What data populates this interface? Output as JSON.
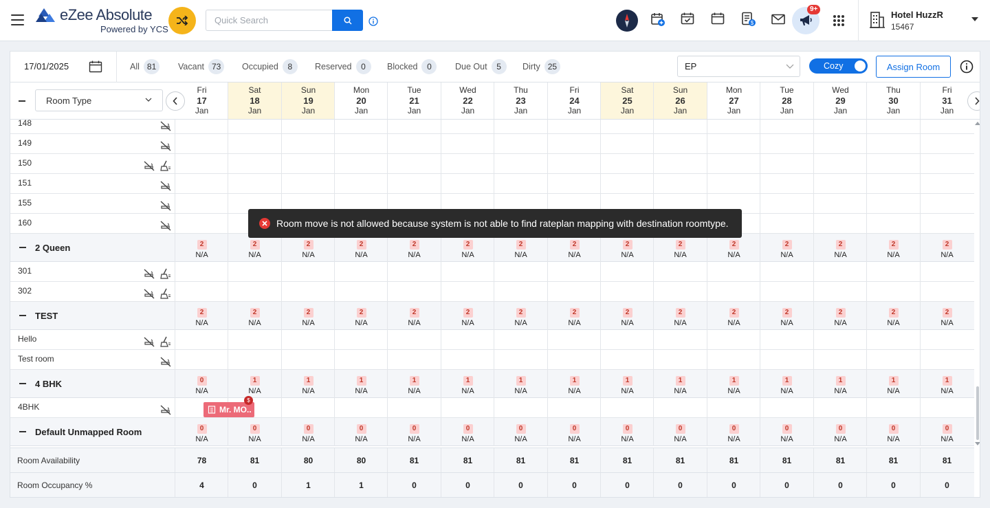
{
  "app": {
    "title": "eZee Absolute",
    "subtitle": "Powered by YCS"
  },
  "search": {
    "placeholder": "Quick Search"
  },
  "notifications": {
    "badge": "9+"
  },
  "hotel": {
    "name": "Hotel HuzzR",
    "id": "15467"
  },
  "toolbar": {
    "date": "17/01/2025",
    "filters": [
      {
        "label": "All",
        "count": "81"
      },
      {
        "label": "Vacant",
        "count": "73"
      },
      {
        "label": "Occupied",
        "count": "8"
      },
      {
        "label": "Reserved",
        "count": "0"
      },
      {
        "label": "Blocked",
        "count": "0"
      },
      {
        "label": "Due Out",
        "count": "5"
      },
      {
        "label": "Dirty",
        "count": "25"
      }
    ],
    "rateplan": "EP",
    "view_toggle": "Cozy",
    "assign_label": "Assign Room"
  },
  "grid": {
    "room_type_select": "Room Type",
    "dates": [
      {
        "dow": "Fri",
        "day": "17",
        "mon": "Jan",
        "weekend": false
      },
      {
        "dow": "Sat",
        "day": "18",
        "mon": "Jan",
        "weekend": true
      },
      {
        "dow": "Sun",
        "day": "19",
        "mon": "Jan",
        "weekend": true
      },
      {
        "dow": "Mon",
        "day": "20",
        "mon": "Jan",
        "weekend": false
      },
      {
        "dow": "Tue",
        "day": "21",
        "mon": "Jan",
        "weekend": false
      },
      {
        "dow": "Wed",
        "day": "22",
        "mon": "Jan",
        "weekend": false
      },
      {
        "dow": "Thu",
        "day": "23",
        "mon": "Jan",
        "weekend": false
      },
      {
        "dow": "Fri",
        "day": "24",
        "mon": "Jan",
        "weekend": false
      },
      {
        "dow": "Sat",
        "day": "25",
        "mon": "Jan",
        "weekend": true
      },
      {
        "dow": "Sun",
        "day": "26",
        "mon": "Jan",
        "weekend": true
      },
      {
        "dow": "Mon",
        "day": "27",
        "mon": "Jan",
        "weekend": false
      },
      {
        "dow": "Tue",
        "day": "28",
        "mon": "Jan",
        "weekend": false
      },
      {
        "dow": "Wed",
        "day": "29",
        "mon": "Jan",
        "weekend": false
      },
      {
        "dow": "Thu",
        "day": "30",
        "mon": "Jan",
        "weekend": false
      },
      {
        "dow": "Fri",
        "day": "31",
        "mon": "Jan",
        "weekend": false
      }
    ],
    "rows": [
      {
        "kind": "room",
        "name": "148",
        "icons": [
          "no-smoking"
        ]
      },
      {
        "kind": "room",
        "name": "149",
        "icons": [
          "no-smoking"
        ]
      },
      {
        "kind": "room",
        "name": "150",
        "icons": [
          "no-smoking",
          "housekeeping"
        ]
      },
      {
        "kind": "room",
        "name": "151",
        "icons": [
          "no-smoking"
        ]
      },
      {
        "kind": "room",
        "name": "155",
        "icons": [
          "no-smoking"
        ]
      },
      {
        "kind": "room",
        "name": "160",
        "icons": [
          "no-smoking"
        ]
      },
      {
        "kind": "type",
        "name": "2 Queen",
        "avail": [
          "2",
          "2",
          "2",
          "2",
          "2",
          "2",
          "2",
          "2",
          "2",
          "2",
          "2",
          "2",
          "2",
          "2",
          "2"
        ],
        "rate": "N/A"
      },
      {
        "kind": "room",
        "name": "301",
        "icons": [
          "no-smoking",
          "housekeeping"
        ]
      },
      {
        "kind": "room",
        "name": "302",
        "icons": [
          "no-smoking",
          "housekeeping"
        ]
      },
      {
        "kind": "type",
        "name": "TEST",
        "avail": [
          "2",
          "2",
          "2",
          "2",
          "2",
          "2",
          "2",
          "2",
          "2",
          "2",
          "2",
          "2",
          "2",
          "2",
          "2"
        ],
        "rate": "N/A"
      },
      {
        "kind": "room",
        "name": "Hello",
        "icons": [
          "no-smoking",
          "housekeeping"
        ]
      },
      {
        "kind": "room",
        "name": "Test room",
        "icons": [
          "no-smoking"
        ]
      },
      {
        "kind": "type",
        "name": "4 BHK",
        "avail": [
          "0",
          "1",
          "1",
          "1",
          "1",
          "1",
          "1",
          "1",
          "1",
          "1",
          "1",
          "1",
          "1",
          "1",
          "1"
        ],
        "rate": "N/A"
      },
      {
        "kind": "room",
        "name": "4BHK",
        "icons": [
          "no-smoking"
        ],
        "booking": {
          "guest": "Mr. MO..",
          "badge": "$"
        }
      },
      {
        "kind": "type",
        "name": "Default Unmapped Room",
        "avail": [
          "0",
          "0",
          "0",
          "0",
          "0",
          "0",
          "0",
          "0",
          "0",
          "0",
          "0",
          "0",
          "0",
          "0",
          "0"
        ],
        "rate": "N/A"
      }
    ],
    "footer": [
      {
        "label": "Room Availability",
        "values": [
          "78",
          "81",
          "80",
          "80",
          "81",
          "81",
          "81",
          "81",
          "81",
          "81",
          "81",
          "81",
          "81",
          "81",
          "81"
        ]
      },
      {
        "label": "Room Occupancy %",
        "values": [
          "4",
          "0",
          "1",
          "1",
          "0",
          "0",
          "0",
          "0",
          "0",
          "0",
          "0",
          "0",
          "0",
          "0",
          "0"
        ]
      }
    ]
  },
  "toast": {
    "message": "Room move is not allowed because system is not able to find rateplan mapping with destination roomtype."
  },
  "colors": {
    "accent": "#1170e4",
    "switch": "#f5b41a",
    "weekend": "#fdf6dc",
    "booking": "#ec6a78",
    "error": "#e53935"
  }
}
